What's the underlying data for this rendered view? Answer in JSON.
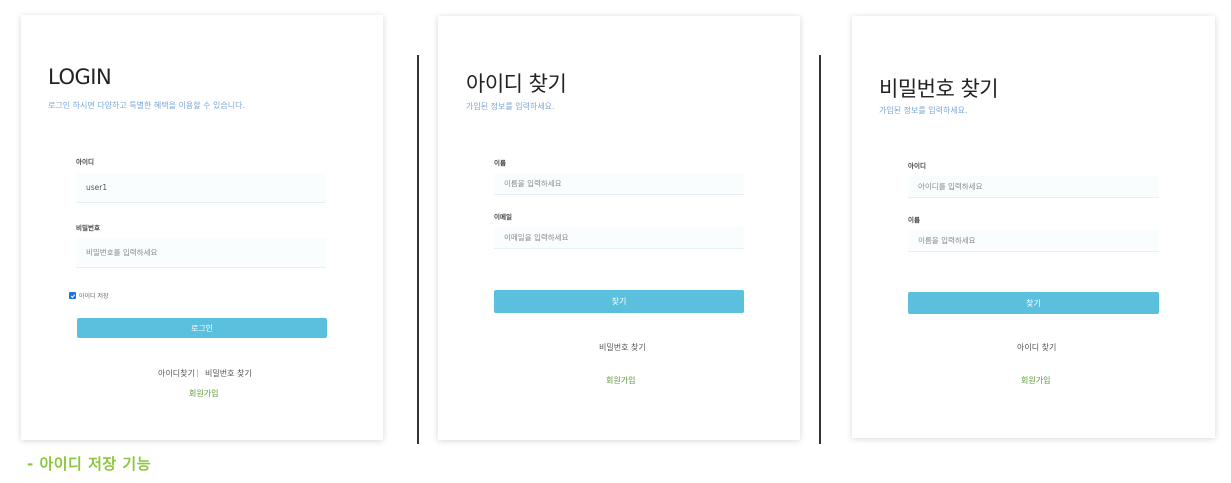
{
  "login": {
    "title": "LOGIN",
    "subtitle": "로그인 하시면 다양하고 특별한 혜택을 이용할 수 있습니다.",
    "id_label": "아이디",
    "id_value": "user1",
    "pw_label": "비밀번호",
    "pw_placeholder": "비밀번호를 입력하세요",
    "remember_label": "아이디 저장",
    "remember_checked": true,
    "login_button": "로그인",
    "find_id_link": "아이디찾기",
    "separator": "|",
    "find_pw_link": "비밀번호 찾기",
    "signup_link": "회원가입"
  },
  "find_id": {
    "title": "아이디 찾기",
    "subtitle": "가입된 정보를 입력하세요.",
    "name_label": "이름",
    "name_placeholder": "이름을 입력하세요",
    "email_label": "이메일",
    "email_placeholder": "이메일을 입력하세요",
    "find_button": "찾기",
    "find_pw_link": "비밀번호 찾기",
    "signup_link": "회원가입"
  },
  "find_pw": {
    "title": "비밀번호 찾기",
    "subtitle": "가입된 정보를 입력하세요.",
    "id_label": "아이디",
    "id_placeholder": "아이디를 입력하세요",
    "name_label": "이름",
    "name_placeholder": "이름을 입력하세요",
    "find_button": "찾기",
    "find_id_link": "아이디 찾기",
    "signup_link": "회원가입"
  },
  "caption": "- 아이디 저장 기능",
  "colors": {
    "button": "#5bc0de",
    "subtitle": "#7aa7d6",
    "signup_link": "#5a9a3a",
    "caption": "#8dc63f",
    "checkbox": "#1a73e8"
  },
  "icons": {
    "checkbox": "check-icon"
  }
}
